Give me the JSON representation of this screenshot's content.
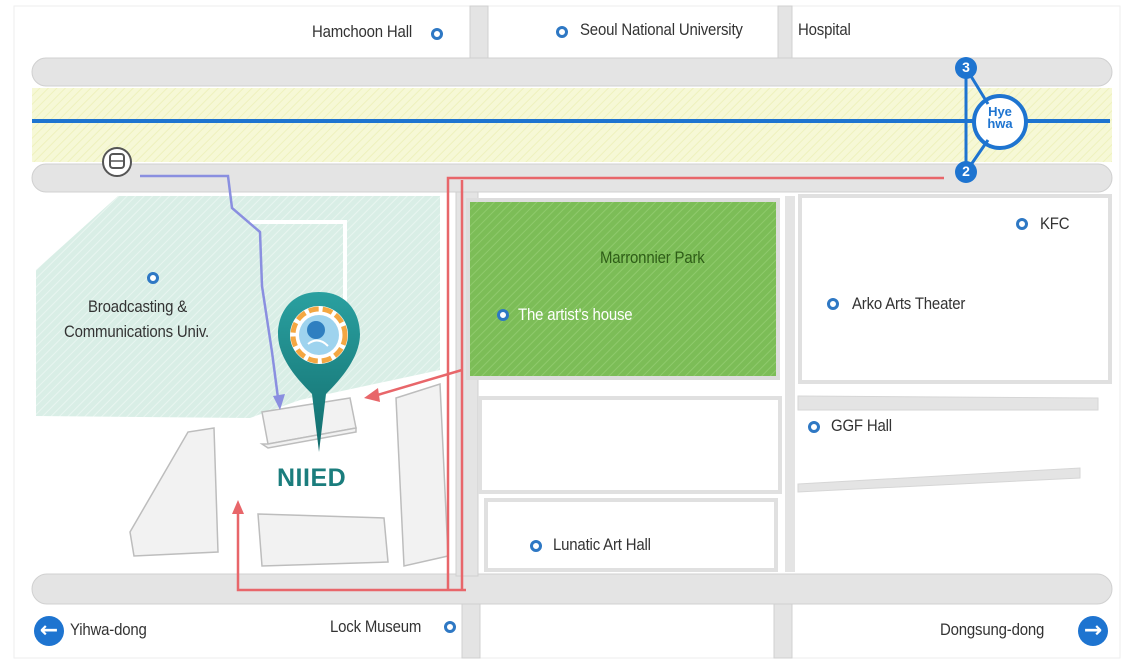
{
  "map": {
    "places": {
      "hamchoon_hall": "Hamchoon Hall",
      "snu_hospital_left": "Seoul National University",
      "snu_hospital_right": "Hospital",
      "kfc": "KFC",
      "marronnier_park": "Marronnier Park",
      "artists_house": "The artist's house",
      "arko_arts_theater": "Arko Arts Theater",
      "broadcasting_line1": "Broadcasting &",
      "broadcasting_line2": "Communications Univ.",
      "ggf_hall": "GGF Hall",
      "lunatic_art_hall": "Lunatic Art Hall",
      "lock_museum": "Lock Museum",
      "niied": "NIIED"
    },
    "station": {
      "line1": "Hye",
      "line2": "hwa",
      "exit_top": "3",
      "exit_bottom": "2"
    },
    "directions": {
      "left": "Yihwa-dong",
      "right": "Dongsung-dong"
    },
    "colors": {
      "road": "#e3e3e3",
      "subway_line": "#1e74d0",
      "subway_band": "#f4f7cf",
      "park": "#7fbf5a",
      "campus": "#dcefe8",
      "route_walk_station": "#e8666a",
      "route_walk_bus": "#8a8fe0",
      "pin": "#1b8a8a"
    }
  }
}
